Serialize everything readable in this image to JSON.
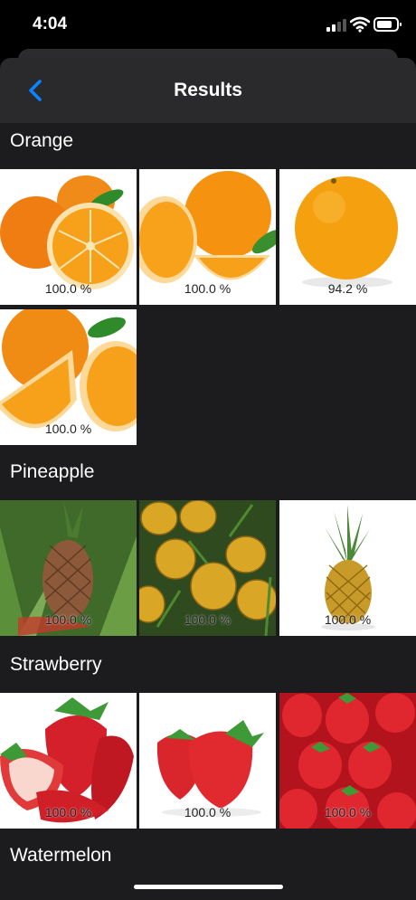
{
  "status": {
    "time": "4:04"
  },
  "nav": {
    "title": "Results",
    "back_icon": "chevron-left-icon",
    "accent": "#0a84ff"
  },
  "sections": [
    {
      "title": "Orange",
      "items": [
        {
          "pct": "100.0 %",
          "kind": "orange"
        },
        {
          "pct": "100.0 %",
          "kind": "orange"
        },
        {
          "pct": "94.2 %",
          "kind": "orange"
        },
        {
          "pct": "100.0 %",
          "kind": "orange"
        }
      ]
    },
    {
      "title": "Pineapple",
      "items": [
        {
          "pct": "100.0 %",
          "kind": "pineapple"
        },
        {
          "pct": "100.0 %",
          "kind": "pineapple"
        },
        {
          "pct": "100.0 %",
          "kind": "pineapple"
        }
      ]
    },
    {
      "title": "Strawberry",
      "items": [
        {
          "pct": "100.0 %",
          "kind": "strawberry"
        },
        {
          "pct": "100.0 %",
          "kind": "strawberry"
        },
        {
          "pct": "100.0 %",
          "kind": "strawberry"
        }
      ]
    },
    {
      "title": "Watermelon",
      "items": []
    }
  ]
}
